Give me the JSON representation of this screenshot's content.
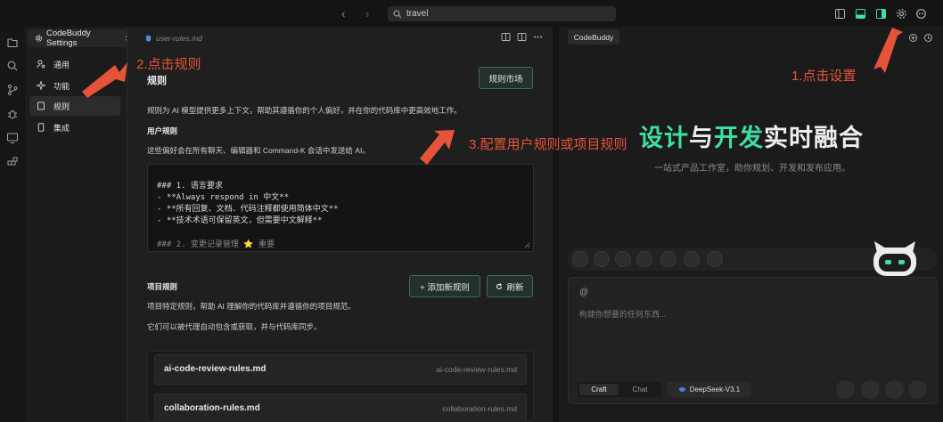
{
  "titlebar": {
    "back_glyph": "‹",
    "forward_glyph": "›",
    "search_value": "travel"
  },
  "settings_tab": {
    "label": "CodeBuddy Settings",
    "close_glyph": "×"
  },
  "sidebar": {
    "items": [
      {
        "label": "通用",
        "icon": "user-settings-icon"
      },
      {
        "label": "功能",
        "icon": "sparkle-icon"
      },
      {
        "label": "规则",
        "icon": "document-icon",
        "active": true
      },
      {
        "label": "集成",
        "icon": "phone-icon"
      }
    ]
  },
  "editor": {
    "file_tab": "user-rules.md",
    "title": "规则",
    "market_button": "规则市场",
    "description": "规则为 AI 模型提供更多上下文，帮助其遵循你的个人偏好，并在你的代码库中更高效地工作。",
    "user_rules_heading": "用户规则",
    "user_rules_desc": "这些偏好会在所有聊天、编辑器和 Command-K 会话中发送给 AI。",
    "code_lines": [
      "### 1. 语言要求",
      "- **Always respond in 中文**",
      "- **所有回复、文档、代码注释都使用简体中文**",
      "- **技术术语可保留英文，但需要中文解释**",
      "### 2. 变更记录管理 ⭐ 重要"
    ],
    "project_rules_heading": "项目规则",
    "add_rule_button": "+ 添加新规则",
    "refresh_button": "刷新",
    "project_desc_1": "项目特定规则，帮助 AI 理解你的代码库并遵循你的项目规范。",
    "project_desc_2": "它们可以被代理自动包含或获取，并与代码库同步。",
    "rules": [
      {
        "name": "ai-code-review-rules.md",
        "file": "ai-code-review-rules.md"
      },
      {
        "name": "collaboration-rules.md",
        "file": "collaboration-rules.md"
      }
    ]
  },
  "chat": {
    "tab": "CodeBuddy",
    "hero_parts": [
      {
        "text": "设计",
        "color": "#3ee0a0"
      },
      {
        "text": "与",
        "color": "#eeeeee"
      },
      {
        "text": "开发",
        "color": "#3ee0a0"
      },
      {
        "text": "实时融合",
        "color": "#eeeeee"
      }
    ],
    "hero_subtitle": "一站式产品工作室，助你规划、开发和发布应用。",
    "mention": "@",
    "input_placeholder": "构建你想要的任何东西...",
    "mode_craft": "Craft",
    "mode_chat": "Chat",
    "model": "DeepSeek-V3.1"
  },
  "annotations": {
    "step1": "1.点击设置",
    "step2": "2.点击规则",
    "step3": "3.配置用户规则或项目规则"
  },
  "colors": {
    "accent": "#3ee0a0",
    "annotation": "#e5533a",
    "button_border": "#3c6b5c"
  }
}
